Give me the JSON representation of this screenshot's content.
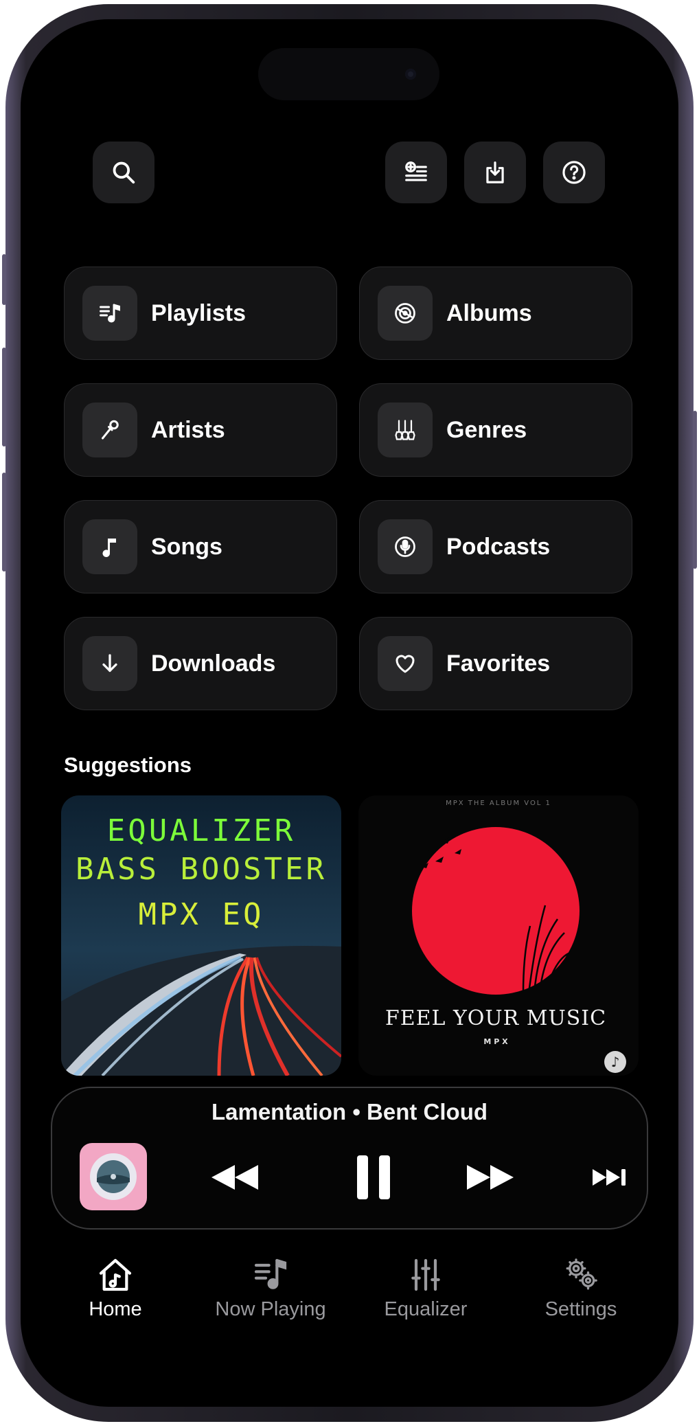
{
  "top_bar": {
    "search_icon": "search-icon",
    "add_playlist_icon": "add-to-queue-icon",
    "import_icon": "download-tray-icon",
    "help_icon": "help-icon"
  },
  "library": [
    {
      "label": "Playlists",
      "icon": "playlist-icon"
    },
    {
      "label": "Albums",
      "icon": "album-icon"
    },
    {
      "label": "Artists",
      "icon": "microphone-icon"
    },
    {
      "label": "Genres",
      "icon": "guitars-icon"
    },
    {
      "label": "Songs",
      "icon": "music-note-icon"
    },
    {
      "label": "Podcasts",
      "icon": "podcast-icon"
    },
    {
      "label": "Downloads",
      "icon": "arrow-down-icon"
    },
    {
      "label": "Favorites",
      "icon": "heart-icon"
    }
  ],
  "suggestions": {
    "title": "Suggestions",
    "items": [
      {
        "lines": [
          "EQUALIZER",
          "BASS BOOSTER",
          "MPX EQ"
        ]
      },
      {
        "top_text": "MPX THE ALBUM VOL 1",
        "headline": "FEEL YOUR MUSIC",
        "sub": "M P X"
      }
    ]
  },
  "now_playing": {
    "track": "Lamentation • Bent Cloud"
  },
  "tabs": [
    {
      "label": "Home",
      "active": true
    },
    {
      "label": "Now Playing",
      "active": false
    },
    {
      "label": "Equalizer",
      "active": false
    },
    {
      "label": "Settings",
      "active": false
    }
  ],
  "colors": {
    "accent_green": "#7dff3a",
    "sun_red": "#ee1833",
    "thumb_pink": "#f2a7c4"
  }
}
